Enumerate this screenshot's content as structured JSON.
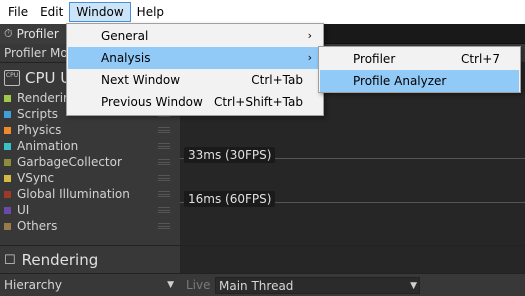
{
  "menubar": {
    "items": [
      "File",
      "Edit",
      "Window",
      "Help"
    ]
  },
  "tabs": {
    "profiler": "Profiler"
  },
  "toolbar": {
    "modules_dropdown": "Profiler Mo"
  },
  "cpu": {
    "badge": "CPU",
    "title": "CPU U",
    "categories": [
      {
        "label": "Rendering",
        "color": "#9ec94a"
      },
      {
        "label": "Scripts",
        "color": "#3ea0d6"
      },
      {
        "label": "Physics",
        "color": "#ee8a2a"
      },
      {
        "label": "Animation",
        "color": "#39c2c2"
      },
      {
        "label": "GarbageCollector",
        "color": "#8c8c3a"
      },
      {
        "label": "VSync",
        "color": "#d6b845"
      },
      {
        "label": "Global Illumination",
        "color": "#9c3a2a"
      },
      {
        "label": "UI",
        "color": "#6b4aa8"
      },
      {
        "label": "Others",
        "color": "#9a7a4a"
      }
    ]
  },
  "chart": {
    "lines": [
      "33ms (30FPS)",
      "16ms (60FPS)"
    ]
  },
  "rendering": {
    "title": "Rendering"
  },
  "bottombar": {
    "view_dropdown": "Hierarchy",
    "live": "Live",
    "thread_dropdown": "Main Thread"
  },
  "window_menu": {
    "items": [
      {
        "label": "General",
        "shortcut": "",
        "submenu": true,
        "highlighted": false
      },
      {
        "label": "Analysis",
        "shortcut": "",
        "submenu": true,
        "highlighted": true
      },
      {
        "label": "Next Window",
        "shortcut": "Ctrl+Tab",
        "submenu": false,
        "highlighted": false
      },
      {
        "label": "Previous Window",
        "shortcut": "Ctrl+Shift+Tab",
        "submenu": false,
        "highlighted": false
      }
    ]
  },
  "analysis_menu": {
    "items": [
      {
        "label": "Profiler",
        "shortcut": "Ctrl+7",
        "highlighted": false
      },
      {
        "label": "Profile Analyzer",
        "shortcut": "",
        "highlighted": true
      }
    ]
  }
}
